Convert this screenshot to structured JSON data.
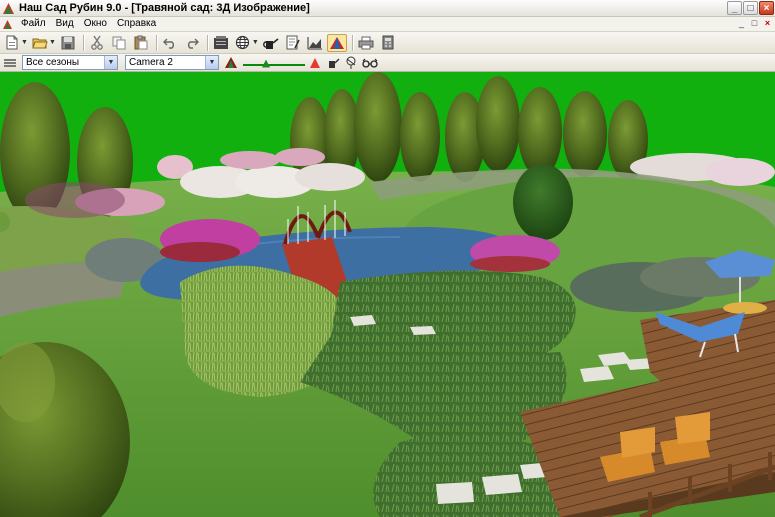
{
  "window": {
    "title": "Наш Сад Рубин 9.0 - [Травяной сад: 3Д Изображение]",
    "controls": [
      "_",
      "□",
      "×"
    ]
  },
  "menu": {
    "items": [
      "Файл",
      "Вид",
      "Окно",
      "Справка"
    ],
    "mdi_controls": [
      "_",
      "□",
      "×"
    ]
  },
  "toolbar": {
    "buttons": [
      {
        "icon": "new-document-icon",
        "dropdown": true
      },
      {
        "icon": "open-folder-icon",
        "dropdown": true
      },
      {
        "icon": "save-icon"
      },
      {
        "icon": "cut-icon"
      },
      {
        "icon": "copy-icon"
      },
      {
        "icon": "paste-icon"
      },
      {
        "icon": "undo-icon"
      },
      {
        "icon": "redo-icon"
      },
      {
        "icon": "plant-catalog-icon"
      },
      {
        "icon": "globe-icon",
        "dropdown": true
      },
      {
        "icon": "watering-can-icon"
      },
      {
        "icon": "notes-icon"
      },
      {
        "icon": "chart-icon"
      },
      {
        "icon": "3d-view-icon",
        "active": true
      },
      {
        "icon": "print-icon"
      },
      {
        "icon": "calculator-icon"
      }
    ]
  },
  "view_toolbar": {
    "season_select": "Все сезоны",
    "camera_select": "Camera 2",
    "light_level": 0.35
  },
  "colors": {
    "sky": "#11b00e",
    "lawn": "#5f9f3c",
    "water": "#3d6fa3",
    "deck": "#8a5a34",
    "bridge": "#b23a2a",
    "umbrella": "#5a8fd6"
  }
}
